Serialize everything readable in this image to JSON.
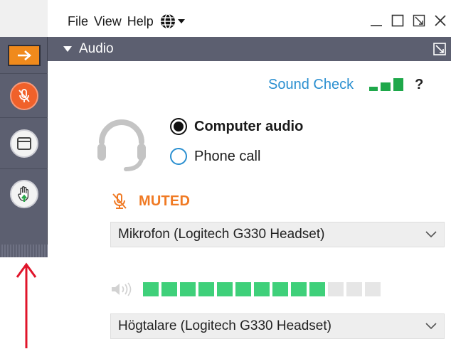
{
  "menu": {
    "file": "File",
    "view": "View",
    "help": "Help"
  },
  "panel": {
    "title": "Audio"
  },
  "sound_check": {
    "label": "Sound Check",
    "help": "?"
  },
  "audio_options": [
    {
      "label": "Computer audio",
      "selected": true
    },
    {
      "label": "Phone call",
      "selected": false
    }
  ],
  "mic": {
    "status": "MUTED",
    "device": "Mikrofon (Logitech G330 Headset)"
  },
  "speaker": {
    "device": "Högtalare (Logitech G330 Headset)",
    "level_active": 10,
    "level_total": 13
  },
  "colors": {
    "accent_orange": "#f08a1c",
    "muted_orange": "#f07a24",
    "link_blue": "#2a8fd0",
    "meter_green": "#3fd07a",
    "sidebar_gray": "#5c5f70",
    "arrow_red": "#e0142a"
  },
  "icons": [
    "collapse-arrow-icon",
    "mic-muted-icon",
    "window-icon",
    "raise-hand-icon",
    "globe-icon",
    "headset-icon",
    "speaker-icon",
    "signal-bars-icon",
    "chevron-down-icon",
    "popout-icon",
    "minimize-icon",
    "maximize-icon",
    "close-icon"
  ]
}
